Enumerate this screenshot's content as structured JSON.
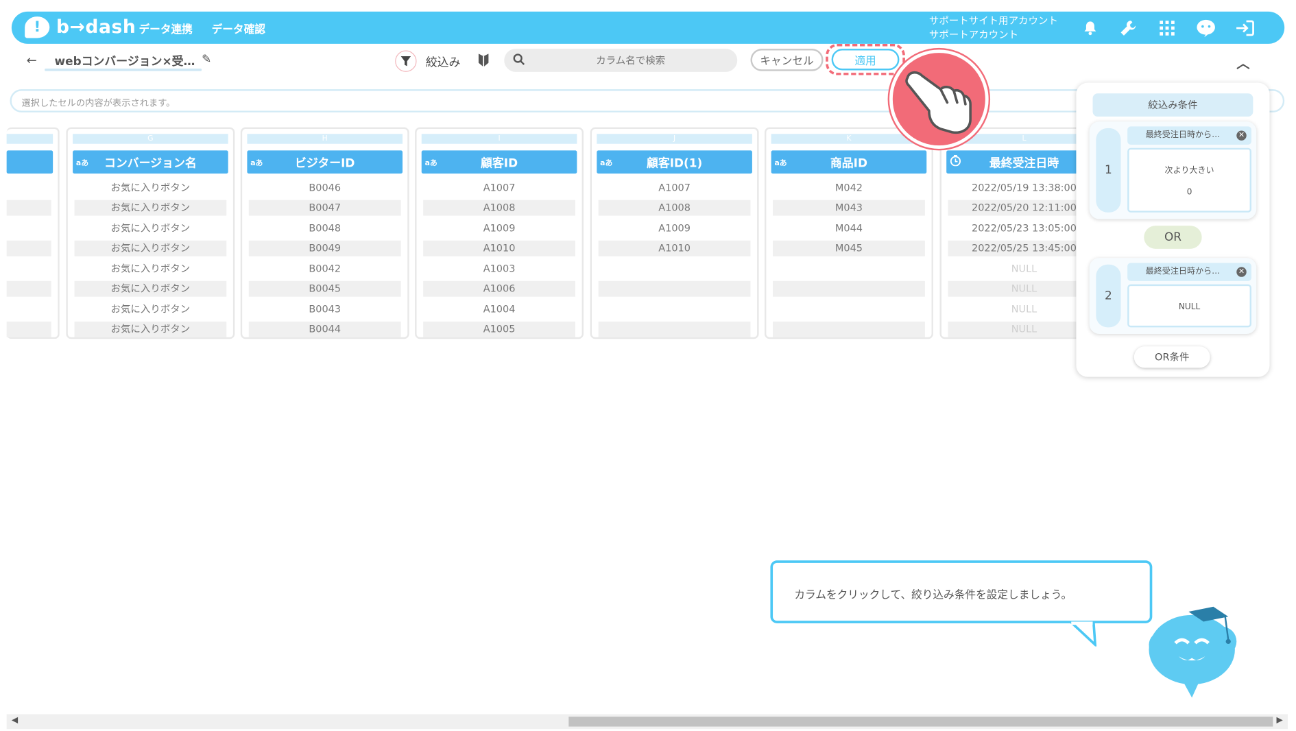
{
  "app": {
    "logo_text": "b→dash",
    "nav": [
      "データ連携",
      "データ確認"
    ],
    "account_line1": "サポートサイト用アカウント",
    "account_line2": "サポートアカウント"
  },
  "toolbar": {
    "title": "webコンバージョン×受…",
    "filter_label": "絞込み",
    "search_placeholder": "カラム名で検索",
    "cancel_label": "キャンセル",
    "apply_label": "適用"
  },
  "cellbar": {
    "placeholder": "選択したセルの内容が表示されます。"
  },
  "grid": {
    "columns": [
      {
        "letter": "G",
        "type": "aあ",
        "name": "コンバージョン名",
        "cells": [
          "お気に入りボタン",
          "お気に入りボタン",
          "お気に入りボタン",
          "お気に入りボタン",
          "お気に入りボタン",
          "お気に入りボタン",
          "お気に入りボタン",
          "お気に入りボタン"
        ]
      },
      {
        "letter": "H",
        "type": "aあ",
        "name": "ビジターID",
        "cells": [
          "B0046",
          "B0047",
          "B0048",
          "B0049",
          "B0042",
          "B0045",
          "B0043",
          "B0044"
        ]
      },
      {
        "letter": "I",
        "type": "aあ",
        "name": "顧客ID",
        "cells": [
          "A1007",
          "A1008",
          "A1009",
          "A1010",
          "A1003",
          "A1006",
          "A1004",
          "A1005"
        ]
      },
      {
        "letter": "J",
        "type": "aあ",
        "name": "顧客ID(1)",
        "cells": [
          "A1007",
          "A1008",
          "A1009",
          "A1010",
          "",
          "",
          "",
          ""
        ]
      },
      {
        "letter": "K",
        "type": "aあ",
        "name": "商品ID",
        "cells": [
          "M042",
          "M043",
          "M044",
          "M045",
          "",
          "",
          "",
          ""
        ]
      },
      {
        "letter": "L",
        "type": "clock",
        "name": "最終受注日時",
        "cells": [
          "2022/05/19 13:38:00",
          "2022/05/20 12:11:00",
          "2022/05/23 13:05:00",
          "2022/05/25 13:45:00",
          "NULL",
          "NULL",
          "NULL",
          "NULL"
        ]
      }
    ]
  },
  "filter_panel": {
    "title": "絞込み条件",
    "conditions": [
      {
        "number": "1",
        "column": "最終受注日時から…",
        "operator": "次より大きい",
        "value": "0"
      },
      {
        "number": "2",
        "column": "最終受注日時から…",
        "operator": "",
        "value": "NULL"
      }
    ],
    "or_label": "OR",
    "or_button": "OR条件"
  },
  "tooltip": {
    "text": "カラムをクリックして、絞り込み条件を設定しましょう。"
  },
  "colors": {
    "brand": "#4cc8f5",
    "header": "#4db3f0",
    "highlight": "#f26b78"
  }
}
